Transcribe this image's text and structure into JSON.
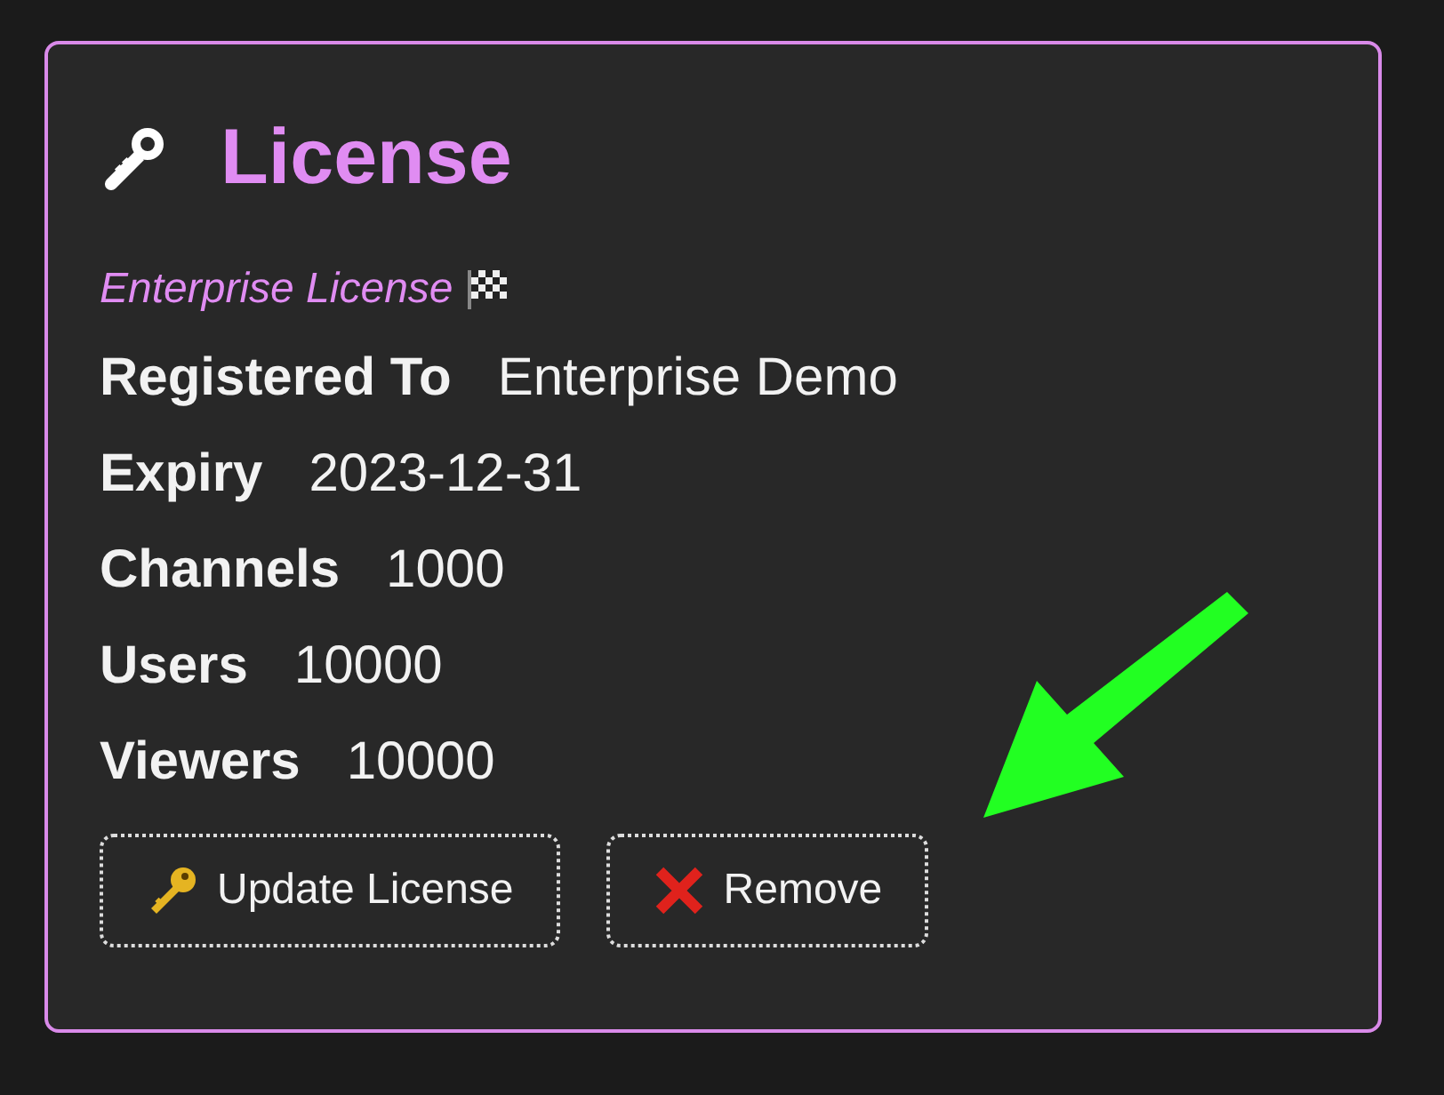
{
  "card": {
    "title": "License",
    "subtitle": "Enterprise License",
    "fields": [
      {
        "label": "Registered To",
        "value": "Enterprise Demo"
      },
      {
        "label": "Expiry",
        "value": "2023-12-31"
      },
      {
        "label": "Channels",
        "value": "1000"
      },
      {
        "label": "Users",
        "value": "10000"
      },
      {
        "label": "Viewers",
        "value": "10000"
      }
    ],
    "buttons": [
      {
        "kind": "update",
        "label": "Update License"
      },
      {
        "kind": "remove",
        "label": "Remove"
      }
    ]
  }
}
